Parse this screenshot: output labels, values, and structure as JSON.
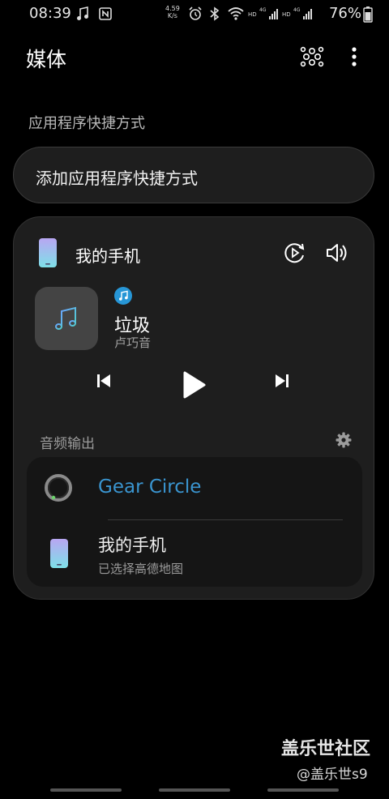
{
  "status_bar": {
    "time": "08:39",
    "net_speed_value": "4.59",
    "net_speed_unit": "K/s",
    "battery_percent": "76%",
    "icons": [
      "music-note-icon",
      "nfc-icon",
      "alarm-icon",
      "bluetooth-icon",
      "wifi-icon",
      "hd-signal-icon",
      "hd-signal-icon",
      "battery-icon"
    ]
  },
  "header": {
    "title": "媒体",
    "actions": [
      "devices-network-icon",
      "more-options-icon"
    ]
  },
  "shortcuts": {
    "section_title": "应用程序快捷方式",
    "add_label": "添加应用程序快捷方式"
  },
  "media_card": {
    "device_name": "我的手机",
    "song_title": "垃圾",
    "artist": "卢巧音",
    "controls": [
      "previous-icon",
      "play-icon",
      "next-icon"
    ],
    "audio_output": {
      "title": "音频输出",
      "devices": [
        {
          "name": "Gear Circle",
          "active": true
        },
        {
          "name": "我的手机",
          "subtitle": "已选择高德地图"
        }
      ]
    }
  },
  "watermark": {
    "line1": "盖乐世社区",
    "line2": "@盖乐世s9"
  },
  "colors": {
    "background": "#000000",
    "card": "#1e1e1e",
    "accent": "#3a95d0",
    "app_badge": "#2796d6"
  }
}
